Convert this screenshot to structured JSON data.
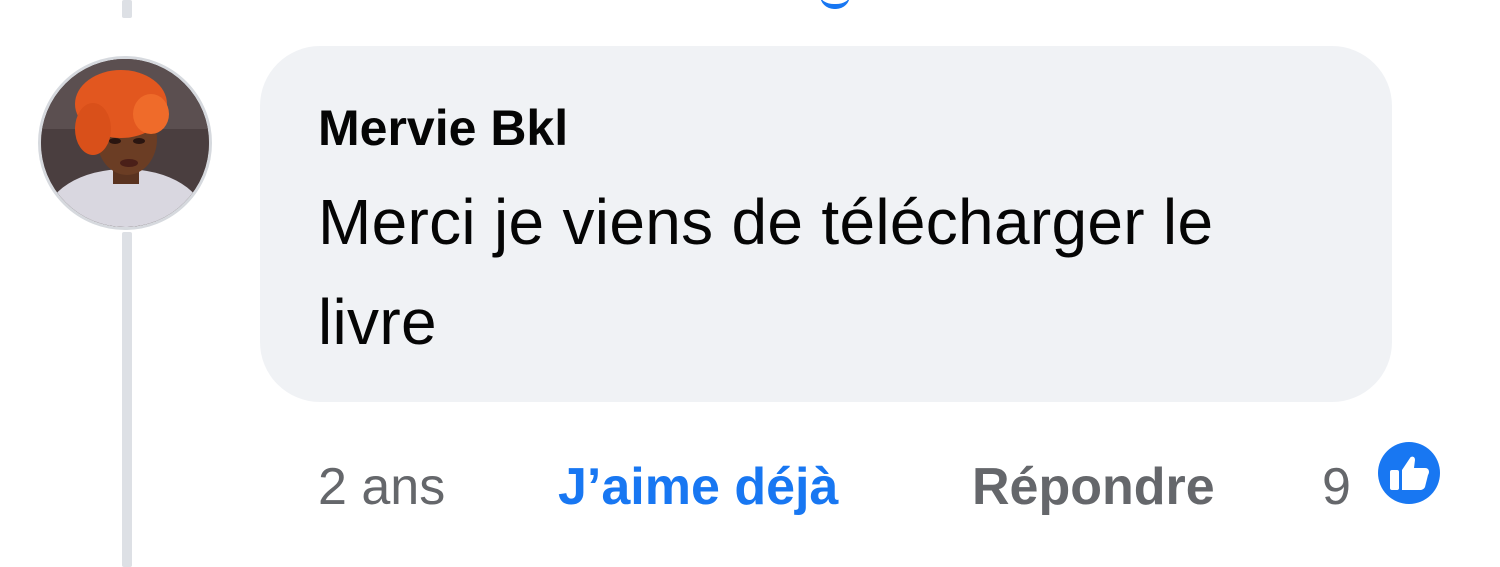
{
  "comment": {
    "author": "Mervie Bkl",
    "text": "Merci je viens de télécharger le livre",
    "time": "2 ans",
    "like_label": "J’aime déjà",
    "reply_label": "Répondre",
    "reaction_count": "9",
    "reaction_icon": "thumbs-up-icon"
  },
  "colors": {
    "accent": "#1877f2",
    "bubble": "#f0f2f5",
    "muted_text": "#65676b",
    "text": "#050505"
  }
}
